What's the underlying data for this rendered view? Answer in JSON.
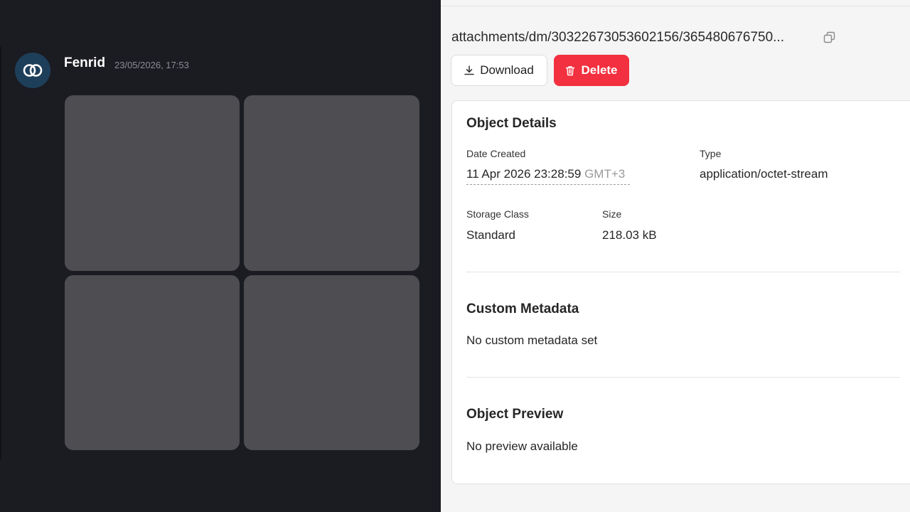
{
  "chat": {
    "username": "Fenrid",
    "timestamp": "23/05/2026, 17:53",
    "avatar_icon": "link-rings-icon",
    "colors": {
      "background": "#1b1b22",
      "avatar": "#1e3f5a",
      "tile": "#4d4d52"
    }
  },
  "object": {
    "path": "attachments/dm/30322673053602156/365480676750...",
    "buttons": {
      "download": "Download",
      "delete": "Delete"
    },
    "details": {
      "heading": "Object Details",
      "date_created_label": "Date Created",
      "date_created_value": "11 Apr 2026 23:28:59",
      "date_created_tz": "GMT+3",
      "type_label": "Type",
      "type_value": "application/octet-stream",
      "storage_class_label": "Storage Class",
      "storage_class_value": "Standard",
      "size_label": "Size",
      "size_value": "218.03 kB"
    },
    "custom_metadata": {
      "heading": "Custom Metadata",
      "empty_text": "No custom metadata set"
    },
    "preview": {
      "heading": "Object Preview",
      "empty_text": "No preview available"
    },
    "colors": {
      "delete": "#f2303f"
    }
  }
}
